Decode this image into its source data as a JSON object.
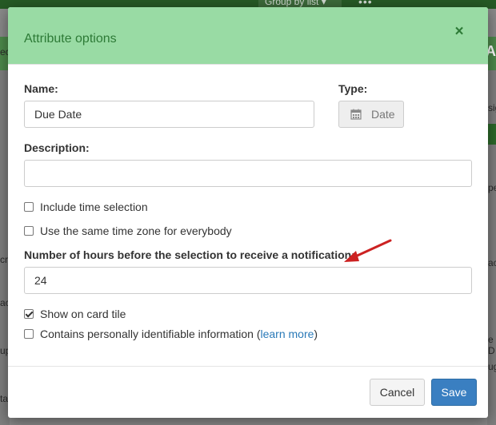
{
  "background": {
    "group_by_label": "Group by list ▾",
    "more_label": "•••",
    "bar_letter": "A",
    "left_fragments": [
      "ec",
      "cr",
      "ac",
      "up",
      "ta"
    ],
    "right_fragments": [
      "sig",
      "pe",
      "ac",
      "e D",
      "ug"
    ]
  },
  "modal": {
    "title": "Attribute options",
    "close_label": "×",
    "name": {
      "label": "Name:",
      "value": "Due Date"
    },
    "type": {
      "label": "Type:",
      "value": "Date",
      "icon": "calendar-icon"
    },
    "description": {
      "label": "Description:",
      "value": ""
    },
    "checkboxes": [
      {
        "label": "Include time selection",
        "checked": false
      },
      {
        "label": "Use the same time zone for everybody",
        "checked": false
      }
    ],
    "notification": {
      "label": "Number of hours before the selection to receive a notification:",
      "value": "24"
    },
    "show_on_card": {
      "label": "Show on card tile",
      "checked": true
    },
    "pii": {
      "label_prefix": "Contains personally identifiable information (",
      "link": "learn more",
      "label_suffix": ")",
      "checked": false
    },
    "buttons": {
      "cancel": "Cancel",
      "save": "Save"
    }
  },
  "colors": {
    "header_bg": "#99dba4",
    "header_text": "#2d7a36",
    "primary_button": "#3a7fc1",
    "annotation_arrow": "#cc2222"
  }
}
